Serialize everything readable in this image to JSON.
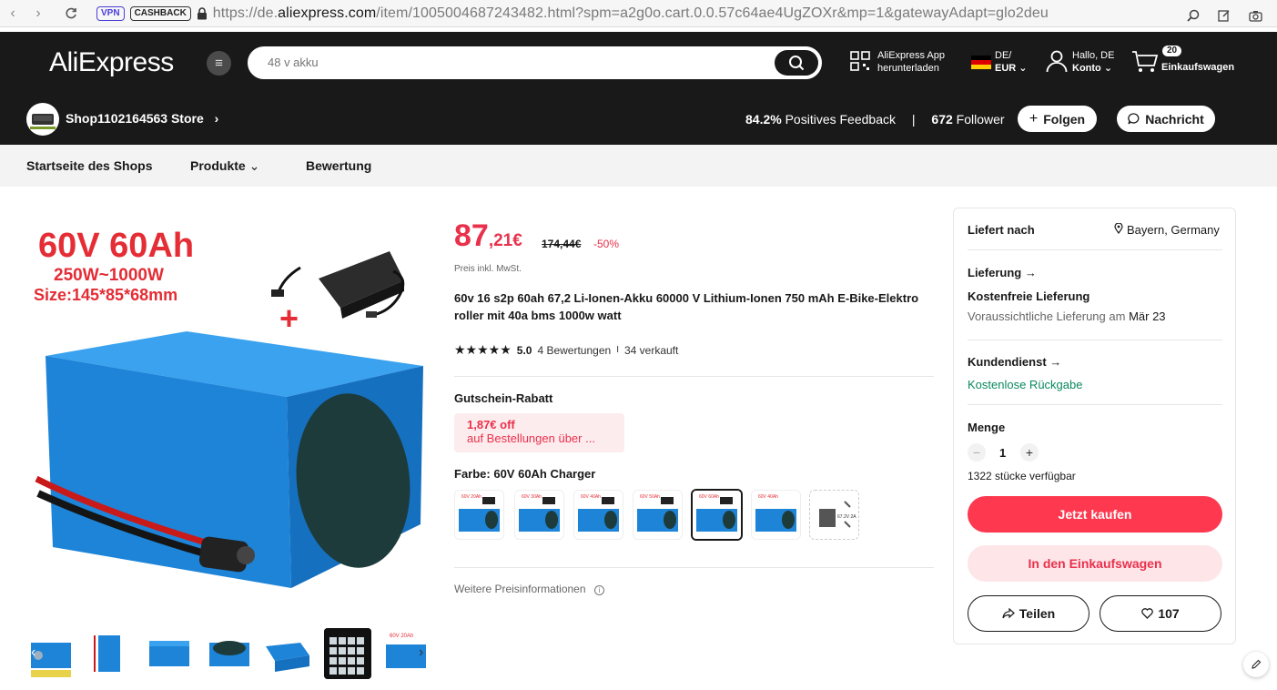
{
  "browser": {
    "url_prefix": "https://de.",
    "url_domain": "aliexpress.com",
    "url_rest": "/item/1005004687243482.html?spm=a2g0o.cart.0.0.57c64ae4UgZOXr&mp=1&gatewayAdapt=glo2deu",
    "vpn_label": "VPN",
    "cashback_label": "CASHBACK"
  },
  "header": {
    "logo": "AliExpress",
    "search_placeholder": "48 v akku",
    "app_line1": "AliExpress App",
    "app_line2": "herunterladen",
    "locale_line1": "DE/",
    "locale_line2": "EUR",
    "account_line1": "Hallo, DE",
    "account_line2": "Konto",
    "cart_count": "20",
    "cart_label": "Einkaufswagen"
  },
  "store": {
    "name": "Shop1102164563 Store",
    "feedback_value": "84.2%",
    "feedback_label": "Positives Feedback",
    "separator": "|",
    "followers_value": "672",
    "followers_label": "Follower",
    "follow_label": "Folgen",
    "message_label": "Nachricht"
  },
  "nav": {
    "tab_home": "Startseite des Shops",
    "tab_products": "Produkte",
    "tab_reviews": "Bewertung"
  },
  "image": {
    "headline": "60V 60Ah",
    "power": "250W~1000W",
    "size": "Size:145*85*68mm",
    "plus": "+"
  },
  "product": {
    "price_int": "87",
    "price_dec": ",21€",
    "price_old": "174,44€",
    "discount": "-50%",
    "vat_note": "Preis inkl. MwSt.",
    "title": "60v 16 s2p 60ah 67,2 Li-Ionen-Akku 60000 V Lithium-Ionen 750 mAh E-Bike-Elektro roller mit 40a bms 1000w watt",
    "rating": "5.0",
    "reviews": "4 Bewertungen",
    "sold_sep": "I",
    "sold": "34 verkauft",
    "coupon_title": "Gutschein-Rabatt",
    "coupon_value": "1,87€ off",
    "coupon_cond": "auf Bestellungen über ...",
    "color_label": "Farbe: 60V 60Ah Charger",
    "more_price": "Weitere Preisinformationen"
  },
  "sku_labels": [
    "60V 20Ah",
    "60V 30Ah",
    "60V 40Ah",
    "60V 50Ah",
    "60V 60Ah",
    "60V 40Ah",
    "67.2V 2A"
  ],
  "panel": {
    "ship_to_label": "Liefert nach",
    "ship_to_value": "Bayern, Germany",
    "delivery_label": "Lieferung",
    "delivery_free": "Kostenfreie Lieferung",
    "delivery_est": "Voraussichtliche Lieferung am",
    "delivery_date": "Mär 23",
    "service_label": "Kundendienst",
    "service_value": "Kostenlose Rückgabe",
    "qty_label": "Menge",
    "qty_value": "1",
    "stock": "1322 stücke verfügbar",
    "buy_now": "Jetzt kaufen",
    "add_cart": "In den Einkaufswagen",
    "share": "Teilen",
    "wishlist_count": "107"
  },
  "colors": {
    "brand_red": "#e9314c",
    "dark": "#191919",
    "green": "#0a8a5f",
    "battery_blue": "#2b8fe0"
  }
}
